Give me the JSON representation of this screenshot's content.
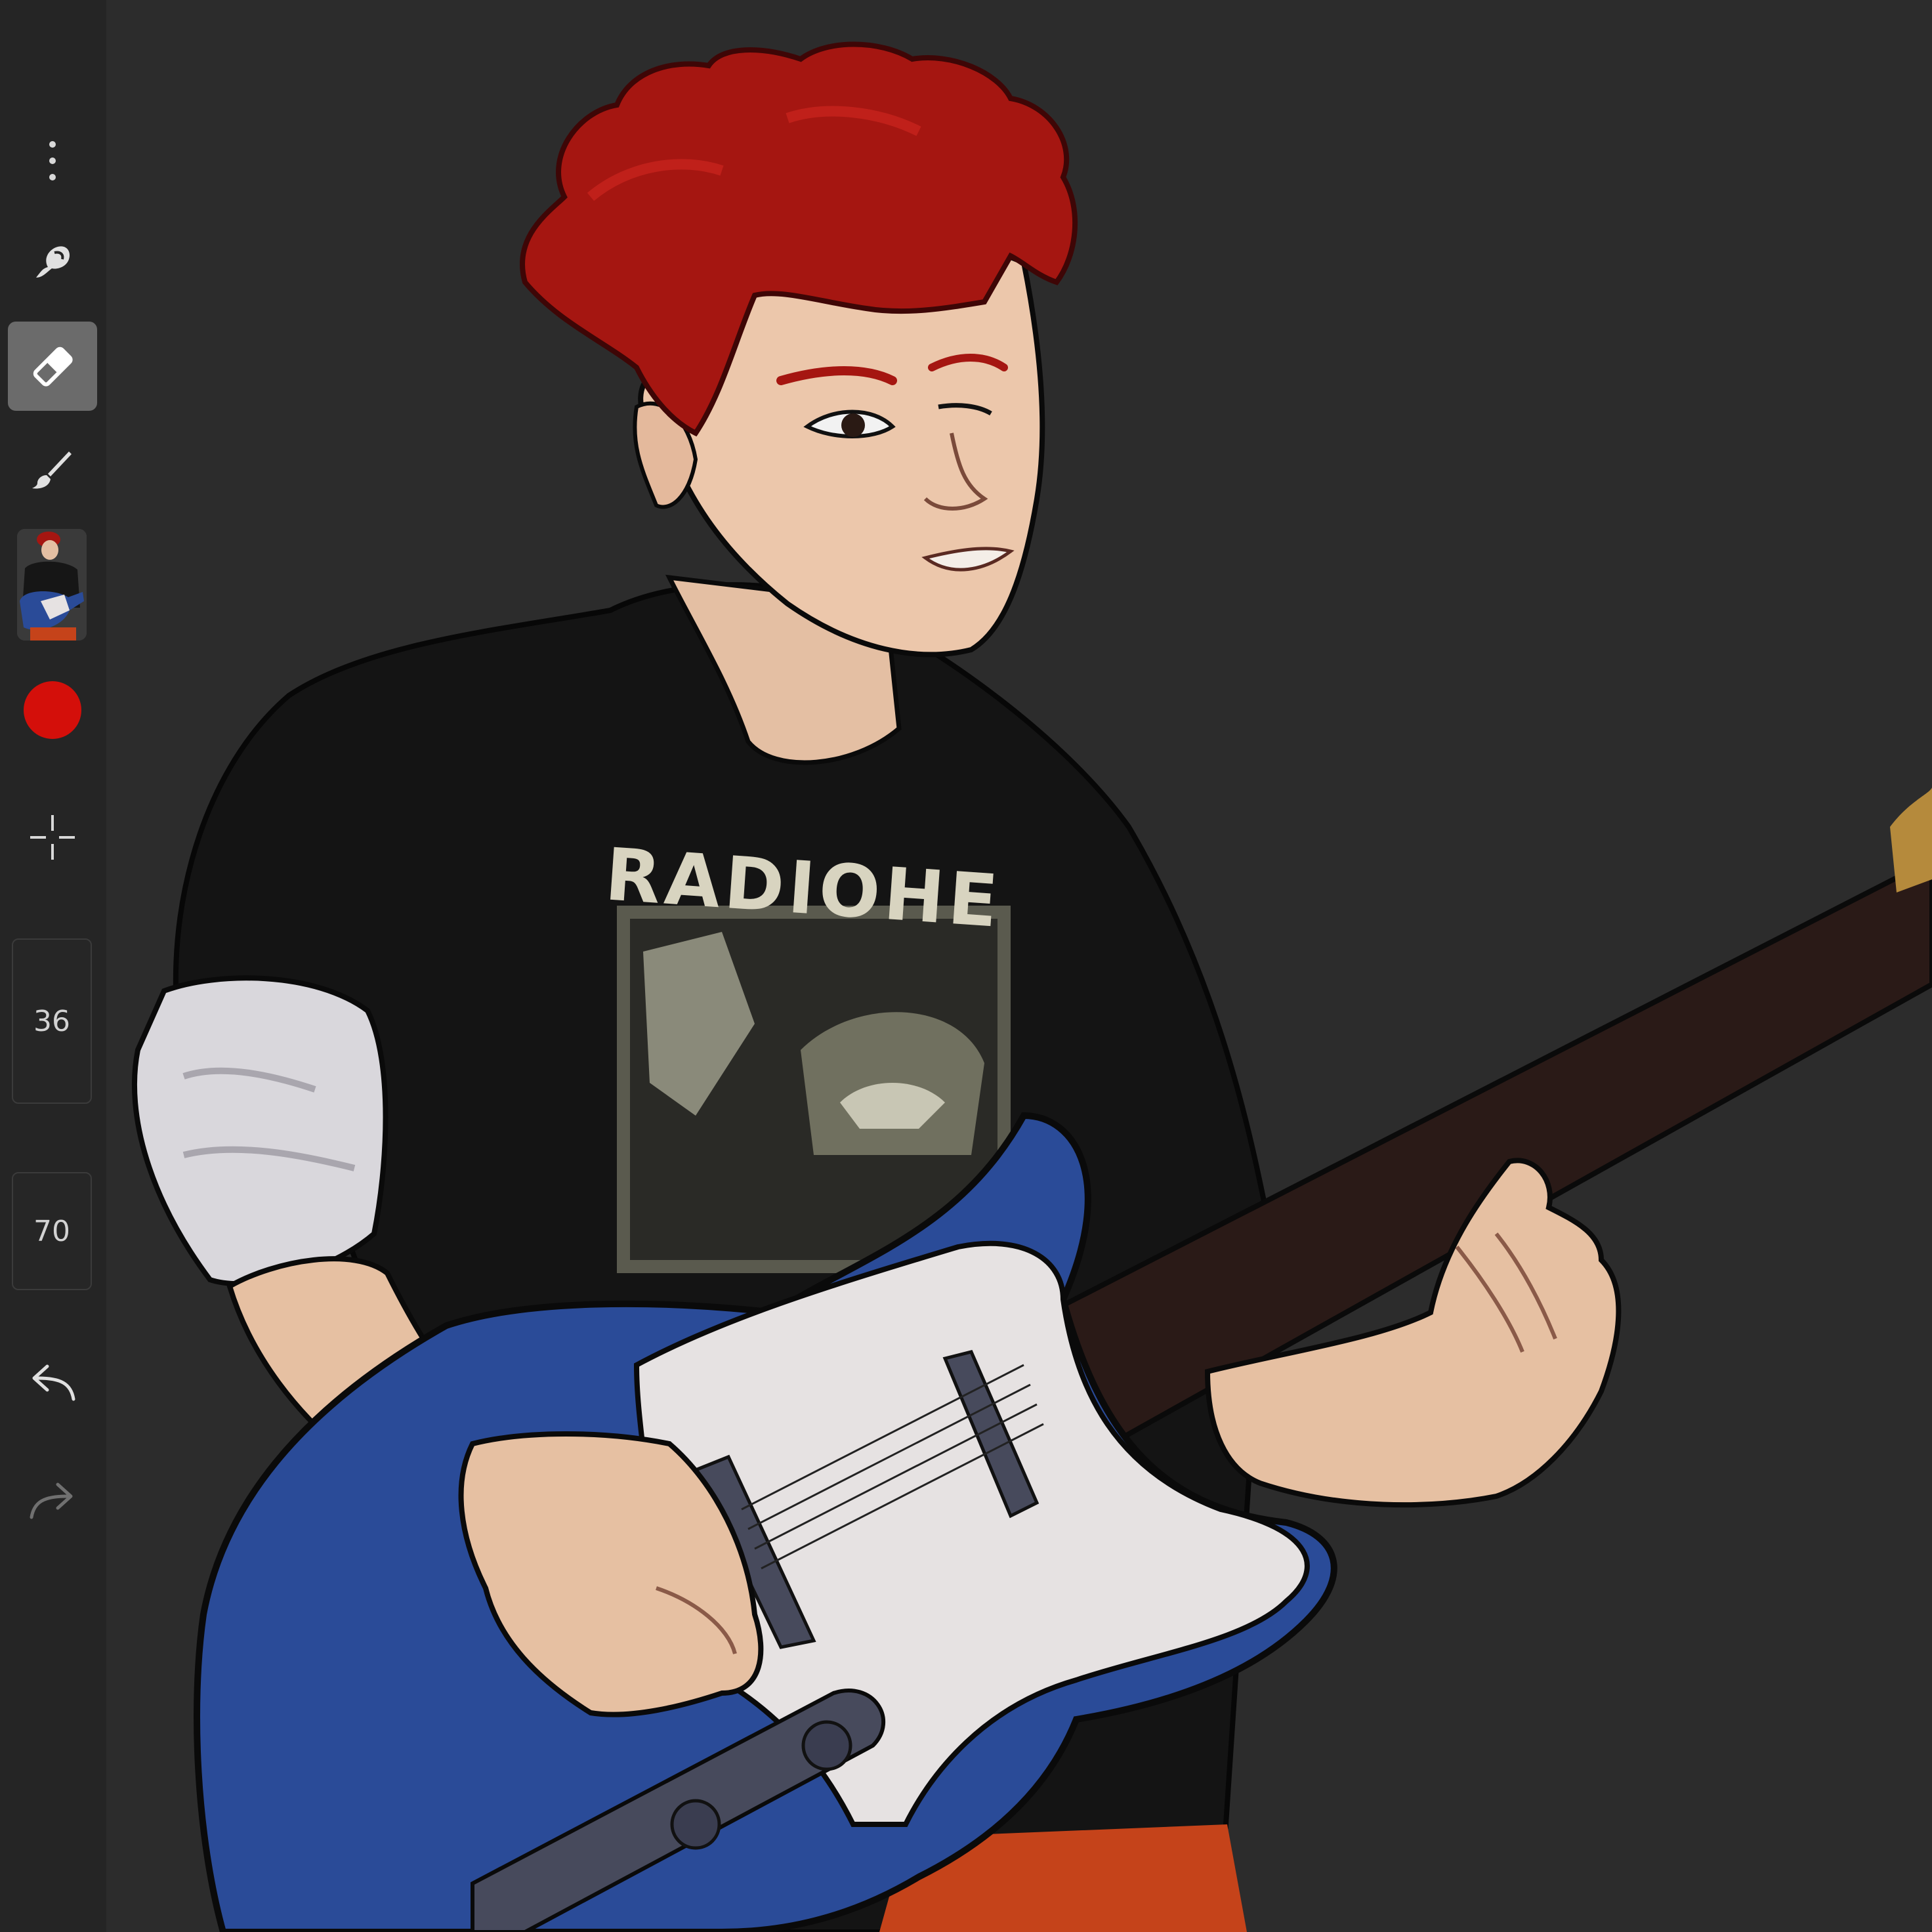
{
  "sidebar": {
    "tools": [
      {
        "name": "more-options",
        "icon": "more-vertical-icon"
      },
      {
        "name": "smudge",
        "icon": "smudge-icon"
      },
      {
        "name": "eraser",
        "icon": "eraser-icon",
        "active": true
      },
      {
        "name": "brush",
        "icon": "brush-icon"
      }
    ],
    "layer_thumbnail": {
      "icon": "layer-thumbnail"
    },
    "color": {
      "icon": "color-swatch",
      "value": "#d40f0a"
    },
    "transform": {
      "icon": "crosshair-icon"
    },
    "brush_size": {
      "value": "36"
    },
    "brush_opacity": {
      "value": "70"
    },
    "undo": {
      "icon": "undo-icon"
    },
    "redo": {
      "icon": "redo-icon",
      "enabled": false
    }
  },
  "canvas": {
    "shirt_text": "RADIOHE",
    "colors": {
      "background": "#2c2c2c",
      "hair": "#a51611",
      "skin": "#e8c2a6",
      "shirt": "#141414",
      "guitar_body": "#2a4b98",
      "pickguard": "#e6e2e2",
      "neck": "#2a1a17",
      "pants": "#c5431a",
      "strap": "#5a1c22"
    }
  }
}
